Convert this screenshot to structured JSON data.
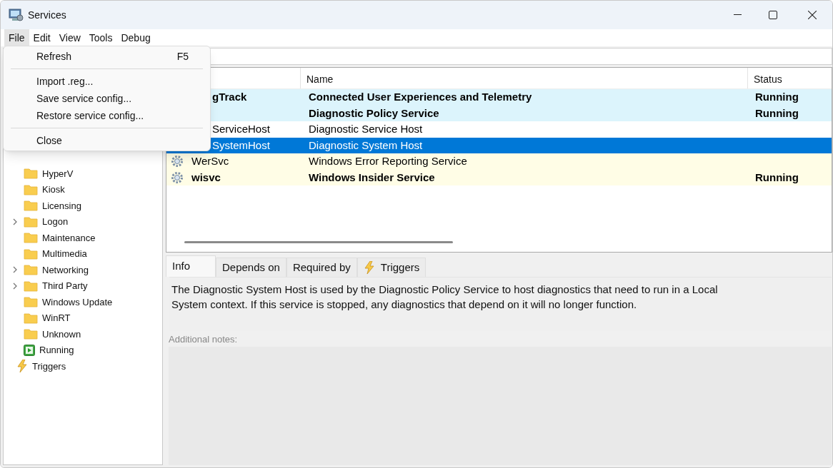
{
  "window": {
    "title": "Services"
  },
  "menubar": [
    {
      "label": "File",
      "selected": true
    },
    {
      "label": "Edit",
      "selected": false
    },
    {
      "label": "View",
      "selected": false
    },
    {
      "label": "Tools",
      "selected": false
    },
    {
      "label": "Debug",
      "selected": false
    }
  ],
  "file_menu": [
    {
      "kind": "item",
      "label": "Refresh",
      "shortcut": "F5"
    },
    {
      "kind": "separator"
    },
    {
      "kind": "item",
      "label": "Import .reg..."
    },
    {
      "kind": "item",
      "label": "Save service config..."
    },
    {
      "kind": "item",
      "label": "Restore service config..."
    },
    {
      "kind": "separator"
    },
    {
      "kind": "item",
      "label": "Close"
    }
  ],
  "tree": [
    {
      "children": [
        {
          "label": "HyperV",
          "kind": "folder",
          "expandable": false
        },
        {
          "label": "Kiosk",
          "kind": "folder",
          "expandable": false
        },
        {
          "label": "Licensing",
          "kind": "folder",
          "expandable": false
        },
        {
          "label": "Logon",
          "kind": "folder",
          "expandable": true
        },
        {
          "label": "Maintenance",
          "kind": "folder",
          "expandable": false
        },
        {
          "label": "Multimedia",
          "kind": "folder",
          "expandable": false
        },
        {
          "label": "Networking",
          "kind": "folder",
          "expandable": true
        },
        {
          "label": "Third Party",
          "kind": "folder",
          "expandable": true
        },
        {
          "label": "Windows Update",
          "kind": "folder",
          "expandable": false
        },
        {
          "label": "WinRT",
          "kind": "folder",
          "expandable": false
        },
        {
          "label": "Unknown",
          "kind": "folder",
          "expandable": false
        },
        {
          "label": "Running",
          "kind": "running",
          "expandable": false
        }
      ]
    },
    {
      "label": "Triggers",
      "kind": "trigger",
      "expandable": false
    }
  ],
  "table": {
    "columns": [
      "Name",
      "Status"
    ],
    "rows": [
      {
        "column_1": "gTrack",
        "name": "Connected User Experiences and Telemetry",
        "status": "Running",
        "bold": true,
        "selected": false,
        "color": "#dcf4fc",
        "covered": true
      },
      {
        "name": "Diagnostic Policy Service",
        "status": "Running",
        "bold": true,
        "selected": false,
        "color": "#dcf4fc"
      },
      {
        "column_1": "ServiceHost",
        "name": "Diagnostic Service Host",
        "bold": false,
        "selected": false,
        "color": "#ffffff",
        "covered": true
      },
      {
        "column_1": "SystemHost",
        "name": "Diagnostic System Host",
        "bold": false,
        "selected": true,
        "covered": true
      },
      {
        "column_1": "WerSvc",
        "name": "Windows Error Reporting Service",
        "bold": false,
        "selected": false,
        "color": "#fffde6",
        "covered": false
      },
      {
        "column_1": "wisvc",
        "name": "Windows Insider Service",
        "status": "Running",
        "bold": true,
        "selected": false,
        "color": "#fffde6",
        "covered": false
      }
    ]
  },
  "tabs": [
    {
      "label": "Info",
      "selected": true,
      "kind": "plain"
    },
    {
      "label": "Depends on",
      "selected": false,
      "kind": "plain"
    },
    {
      "label": "Required by",
      "selected": false,
      "kind": "plain"
    },
    {
      "label": "Triggers",
      "selected": false,
      "kind": "trigger"
    }
  ],
  "info": {
    "description": "The Diagnostic System Host is used by the Diagnostic Policy Service to host diagnostics that need to run in a Local System context.  If this service is stopped, any diagnostics that depend on it will no longer function.",
    "notes_label": "Additional notes:"
  }
}
